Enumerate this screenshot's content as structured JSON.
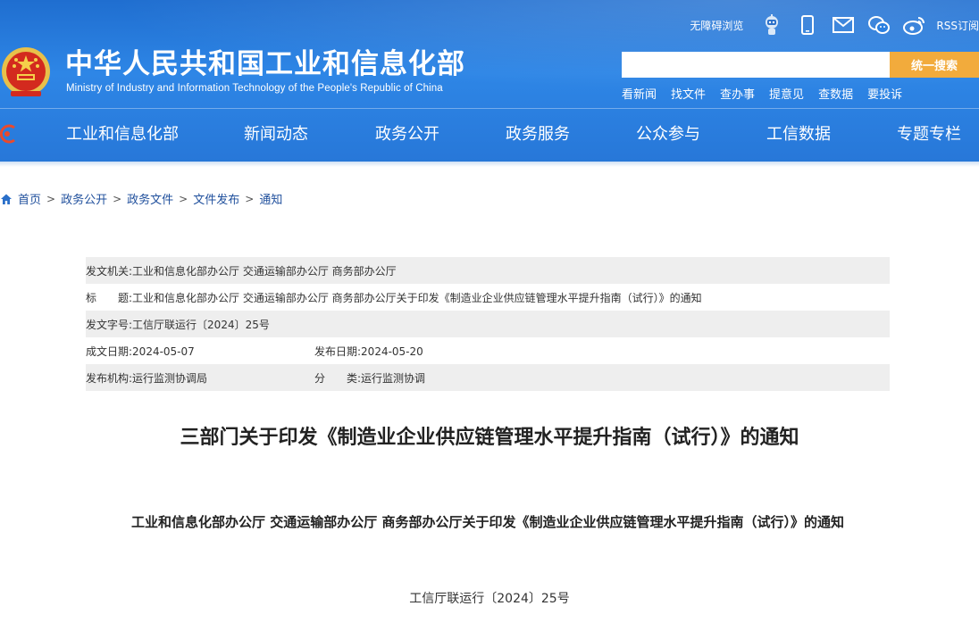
{
  "header": {
    "title": "中华人民共和国工业和信息化部",
    "subtitle": "Ministry of Industry and Information Technology of the People's Republic of China",
    "accessibility_link": "无障碍浏览",
    "rss_label": "RSS订阅",
    "search": {
      "placeholder": "",
      "button_label": "统一搜索"
    },
    "quick_links": [
      "看新闻",
      "找文件",
      "查办事",
      "提意见",
      "查数据",
      "要投诉"
    ],
    "nav_items": [
      "工业和信息化部",
      "新闻动态",
      "政务公开",
      "政务服务",
      "公众参与",
      "工信数据",
      "专题专栏"
    ],
    "icons": [
      "robot-icon",
      "mobile-icon",
      "mail-icon",
      "wechat-icon",
      "weibo-icon"
    ],
    "colors": {
      "header_blue": "#2a7fe0",
      "search_orange": "#f2ab3c",
      "crumb_blue": "#1f4f9c"
    }
  },
  "breadcrumb": [
    "首页",
    "政务公开",
    "政务文件",
    "文件发布",
    "通知"
  ],
  "info": {
    "issuer_label": "发文机关:",
    "issuer_value": "工业和信息化部办公厅 交通运输部办公厅 商务部办公厅",
    "title_label": "标　　题:",
    "title_value": "工业和信息化部办公厅 交通运输部办公厅 商务部办公厅关于印发《制造业企业供应链管理水平提升指南（试行）》的通知",
    "doc_no_label": "发文字号:",
    "doc_no_value": "工信厅联运行〔2024〕25号",
    "created_label": "成文日期:",
    "created_value": "2024-05-07",
    "published_label": "发布日期:",
    "published_value": "2024-05-20",
    "org_label": "发布机构:",
    "org_value": "运行监测协调局",
    "category_label": "分　　类:",
    "category_value": "运行监测协调"
  },
  "article": {
    "title": "三部门关于印发《制造业企业供应链管理水平提升指南（试行）》的通知",
    "subtitle": "工业和信息化部办公厅 交通运输部办公厅 商务部办公厅关于印发《制造业企业供应链管理水平提升指南（试行）》的通知",
    "doc_number": "工信厅联运行〔2024〕25号"
  }
}
